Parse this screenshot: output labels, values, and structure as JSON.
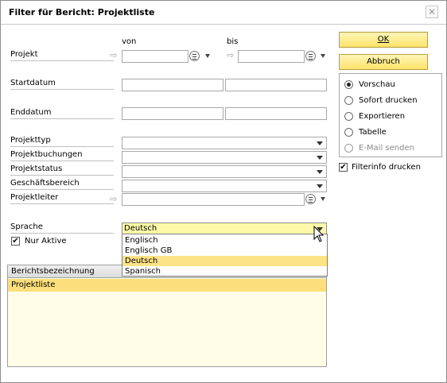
{
  "window": {
    "title": "Filter für Bericht: Projektliste",
    "close_glyph": "✕"
  },
  "form": {
    "col_from": "von",
    "col_to": "bis",
    "labels": {
      "project": "Projekt",
      "start_date": "Startdatum",
      "end_date": "Enddatum",
      "project_type": "Projekttyp",
      "project_bookings": "Projektbuchungen",
      "project_status": "Projektstatus",
      "business_area": "Geschäftsbereich",
      "project_manager": "Projektleiter",
      "language": "Sprache"
    },
    "language_value": "Deutsch",
    "only_active_label": "Nur Aktive",
    "only_active_checked": true,
    "language_options": [
      "Englisch",
      "Englisch GB",
      "Deutsch",
      "Spanisch"
    ],
    "language_selected_index": 2
  },
  "buttons": {
    "ok_label": "OK",
    "cancel_label": "Abbruch"
  },
  "output": {
    "options": [
      "Vorschau",
      "Sofort drucken",
      "Exportieren",
      "Tabelle",
      "E-Mail senden"
    ],
    "selected_index": 0,
    "disabled_index": 4,
    "filterinfo_label": "Filterinfo drucken",
    "filterinfo_checked": true
  },
  "report_table": {
    "header": "Berichtsbezeichnung",
    "rows": [
      "Projektliste"
    ]
  },
  "colors": {
    "button_yellow": "#fce36a",
    "selection_yellow": "#fde387",
    "row_highlight": "#fcdf7c"
  }
}
